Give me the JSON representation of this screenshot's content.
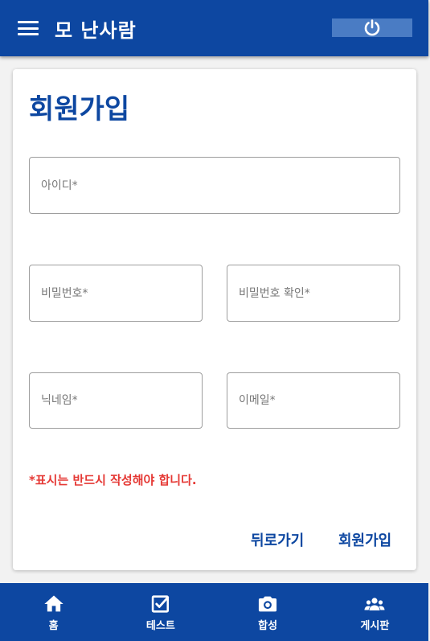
{
  "appbar": {
    "title": "모 난사람",
    "menu_icon": "menu-icon",
    "power_icon": "power-icon"
  },
  "signup": {
    "title": "회원가입",
    "fields": {
      "id_placeholder": "아이디*",
      "password_placeholder": "비밀번호*",
      "password_confirm_placeholder": "비밀번호 확인*",
      "nickname_placeholder": "닉네임*",
      "email_placeholder": "이메일*"
    },
    "notice": "*표시는 반드시 작성해야 합니다.",
    "back_label": "뒤로가기",
    "submit_label": "회원가입"
  },
  "nav": {
    "items": [
      {
        "label": "홈",
        "icon": "home-icon"
      },
      {
        "label": "테스트",
        "icon": "checkbox-icon"
      },
      {
        "label": "합성",
        "icon": "camera-icon"
      },
      {
        "label": "게시판",
        "icon": "people-icon"
      }
    ]
  },
  "colors": {
    "primary": "#0d47a1",
    "accent_button": "#4a7cc4",
    "notice": "#e53935"
  }
}
